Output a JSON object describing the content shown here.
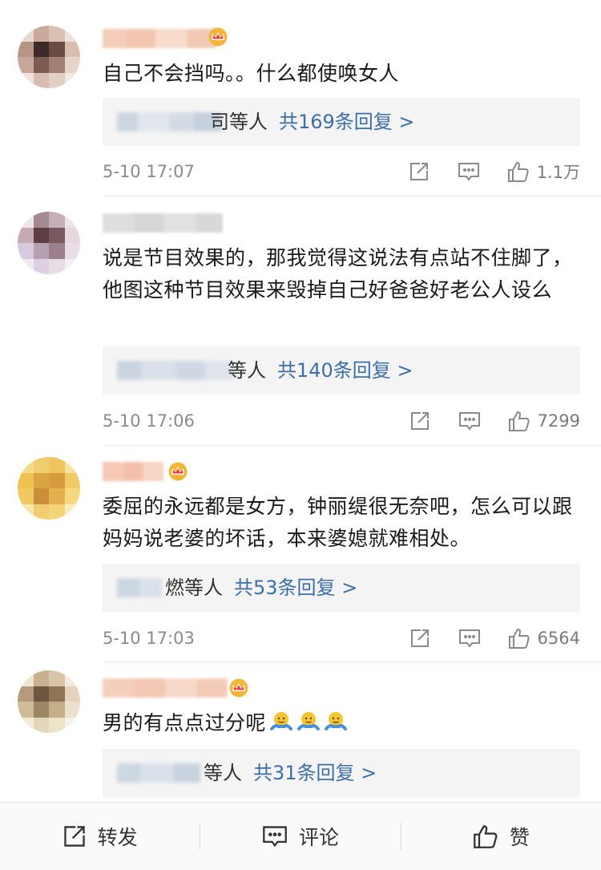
{
  "comments": [
    {
      "text": "自己不会挡吗。。什么都使唤女人",
      "reply_names_tail": "司等人",
      "reply_count": "共169条回复 >",
      "time": "5-10 17:07",
      "likes": "1.1万",
      "has_crown": true
    },
    {
      "text": "说是节目效果的，那我觉得这说法有点站不住脚了，他图这种节目效果来毁掉自己好爸爸好老公人设么",
      "reply_names_tail": "等人",
      "reply_count": "共140条回复 >",
      "time": "5-10 17:06",
      "likes": "7299",
      "has_crown": false
    },
    {
      "text": "委屈的永远都是女方，钟丽缇很无奈吧，怎么可以跟妈妈说老婆的坏话，本来婆媳就难相处。",
      "reply_names_tail": "燃等人",
      "reply_count": "共53条回复 >",
      "time": "5-10 17:03",
      "likes": "6564",
      "has_crown": true
    },
    {
      "text": "男的有点点过分呢",
      "reply_names_tail": "等人",
      "reply_count": "共31条回复 >",
      "has_crown": true,
      "emojis": [
        "shrug-emoji",
        "shrug-emoji",
        "shrug-emoji"
      ]
    }
  ],
  "bottom_bar": {
    "repost_label": "转发",
    "comment_label": "评论",
    "like_label": "赞"
  },
  "colors": {
    "link": "#3c6ea8",
    "meta": "#8a8a8a",
    "reply_bg": "#f4f4f4"
  }
}
